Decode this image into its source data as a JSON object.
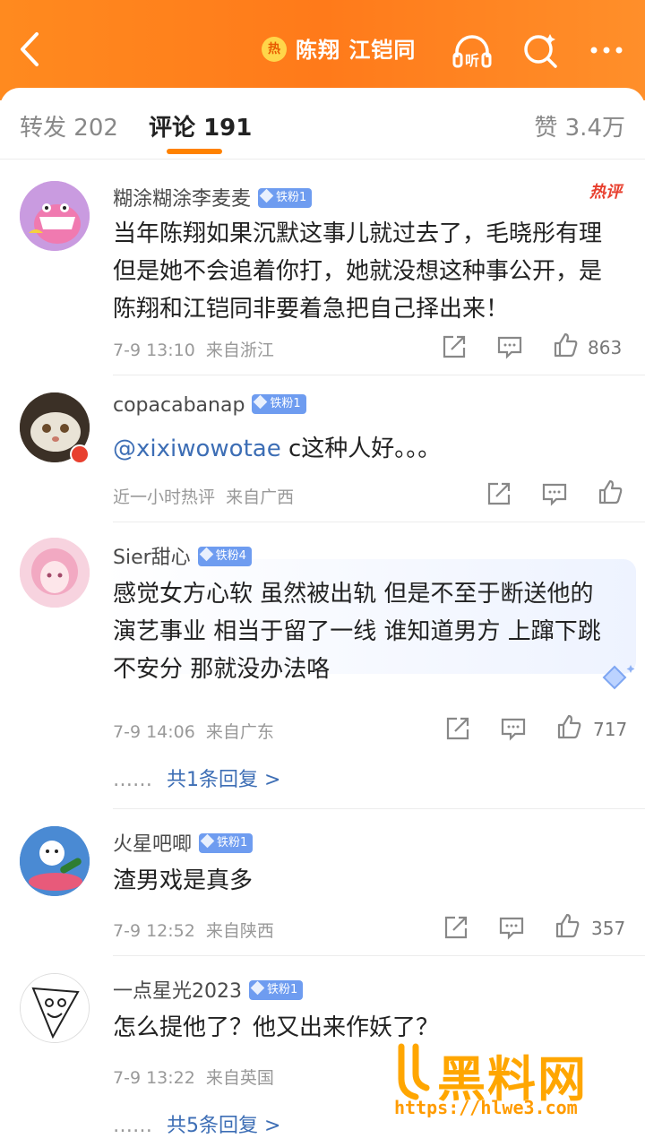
{
  "header": {
    "hot_badge": "热",
    "title": "陈翔 江铠同",
    "icons": [
      "back-icon",
      "listen-icon",
      "search-icon",
      "more-icon"
    ],
    "listen_label": "听"
  },
  "tabs": {
    "repost_label": "转发",
    "repost_count": "202",
    "comment_label": "评论",
    "comment_count": "191",
    "like_label": "赞",
    "like_count": "3.4万"
  },
  "colors": {
    "brand": "#ff8200",
    "link": "#3d6eb5",
    "badge": "#6e9cf0",
    "hot": "#e8402f"
  },
  "comments": [
    {
      "username": "糊涂糊涂李麦麦",
      "badge": "铁粉1",
      "hot_tag": "热评",
      "text": "当年陈翔如果沉默这事儿就过去了，毛晓彤有理但是她不会追着你打，她就没想这种事公开，是陈翔和江铠同非要着急把自己择出来！",
      "time": "7-9 13:10",
      "location": "来自浙江",
      "likes": "863"
    },
    {
      "username": "copacabanap",
      "badge": "铁粉1",
      "mention": "@xixiwowotae",
      "text": " c这种人好。。。",
      "time": "近一小时热评",
      "location": "来自广西",
      "likes": ""
    },
    {
      "username": "Sier甜心",
      "badge": "铁粉4",
      "text": "感觉女方心软  虽然被出轨 但是不至于断送他的演艺事业 相当于留了一线 谁知道男方 上蹿下跳 不安分 那就没办法咯",
      "time": "7-9 14:06",
      "location": "来自广东",
      "likes": "717",
      "replies_dots": "……",
      "replies_link": "共1条回复 >"
    },
    {
      "username": "火星吧唧",
      "badge": "铁粉1",
      "text": "渣男戏是真多",
      "time": "7-9 12:52",
      "location": "来自陕西",
      "likes": "357"
    },
    {
      "username": "一点星光2023",
      "badge": "铁粉1",
      "text": "怎么提他了？他又出来作妖了？",
      "time": "7-9 13:22",
      "location": "来自英国",
      "likes": "",
      "replies_dots": "……",
      "replies_link": "共5条回复 >"
    }
  ],
  "watermark": {
    "text": "黑料网",
    "url": "https://hlwe3.com"
  }
}
